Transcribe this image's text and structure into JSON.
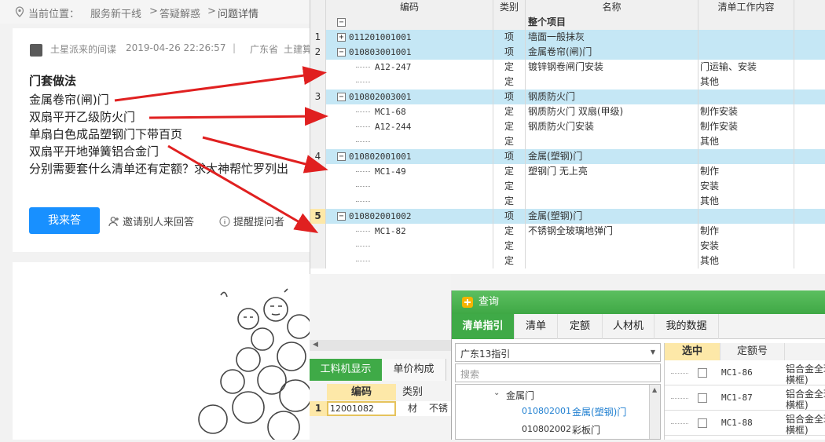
{
  "breadcrumb": {
    "prefix": "当前位置：",
    "items": [
      "服务新干线",
      ">",
      "答疑解惑",
      ">",
      "问题详情"
    ]
  },
  "question": {
    "author": "土星派来的间谍",
    "date": "2019-04-26 22:26:57",
    "sep": "|",
    "region": "广东省",
    "region2": "土建算",
    "title": "门套做法",
    "lines": [
      "金属卷帘(闸)门",
      " 双扇平开乙级防火门",
      "单扇白色成品塑钢门下带百页",
      "双扇平开地弹簧铝合金门",
      "分别需要套什么清单还有定额？求大神帮忙罗列出"
    ],
    "answer_button": "我来答",
    "invite": "邀请别人来回答",
    "remind": "提醒提问者"
  },
  "grid": {
    "headers": [
      "编码",
      "类别",
      "名称",
      "清单工作内容"
    ],
    "rows": [
      {
        "num": "",
        "tog": "−",
        "code": "",
        "type": "",
        "name": "整个项目",
        "work": "",
        "hl": false,
        "bold": true
      },
      {
        "num": "1",
        "tog": "+",
        "code": "011201001001",
        "type": "项",
        "name": "墙面一般抹灰",
        "work": "",
        "hl": true
      },
      {
        "num": "2",
        "tog": "−",
        "code": "010803001001",
        "type": "项",
        "name": "金属卷帘(闸)门",
        "work": "",
        "hl": true
      },
      {
        "num": "",
        "tog": "",
        "code": "A12-247",
        "type": "定",
        "name": "镀锌钢卷闸门安装",
        "work": "门运输、安装",
        "hl": false
      },
      {
        "num": "",
        "tog": "",
        "code": "",
        "type": "定",
        "name": "",
        "work": "其他",
        "hl": false
      },
      {
        "num": "3",
        "tog": "−",
        "code": "010802003001",
        "type": "项",
        "name": "钢质防火门",
        "work": "",
        "hl": true
      },
      {
        "num": "",
        "tog": "",
        "code": "MC1-68",
        "type": "定",
        "name": "钢质防火门 双扇(甲级)",
        "work": "制作安装",
        "hl": false
      },
      {
        "num": "",
        "tog": "",
        "code": "A12-244",
        "type": "定",
        "name": "钢质防火门安装",
        "work": "制作安装",
        "hl": false
      },
      {
        "num": "",
        "tog": "",
        "code": "",
        "type": "定",
        "name": "",
        "work": "其他",
        "hl": false
      },
      {
        "num": "4",
        "tog": "−",
        "code": "010802001001",
        "type": "项",
        "name": "金属(塑钢)门",
        "work": "",
        "hl": true
      },
      {
        "num": "",
        "tog": "",
        "code": "MC1-49",
        "type": "定",
        "name": "塑钢门 无上亮",
        "work": "制作",
        "hl": false
      },
      {
        "num": "",
        "tog": "",
        "code": "",
        "type": "定",
        "name": "",
        "work": "安装",
        "hl": false
      },
      {
        "num": "",
        "tog": "",
        "code": "",
        "type": "定",
        "name": "",
        "work": "其他",
        "hl": false
      },
      {
        "num": "5",
        "tog": "−",
        "code": "010802001002",
        "type": "项",
        "name": "金属(塑钢)门",
        "work": "",
        "hl": true
      },
      {
        "num": "",
        "tog": "",
        "code": "MC1-82",
        "type": "定",
        "name": "不锈钢全玻璃地弹门",
        "work": "制作",
        "hl": false
      },
      {
        "num": "",
        "tog": "",
        "code": "",
        "type": "定",
        "name": "",
        "work": "安装",
        "hl": false
      },
      {
        "num": "",
        "tog": "",
        "code": "",
        "type": "定",
        "name": "",
        "work": "其他",
        "hl": false
      }
    ]
  },
  "lower": {
    "tabs": [
      "工料机显示",
      "单价构成"
    ],
    "headers": [
      "编码",
      "类别"
    ],
    "row": {
      "num": "1",
      "code": "12001082",
      "type": "材",
      "extra": "不锈"
    }
  },
  "query": {
    "title": "查询",
    "tabs": [
      "清单指引",
      "清单",
      "定额",
      "人材机",
      "我的数据"
    ],
    "select_value": "广东13指引",
    "search_placeholder": "搜索",
    "tree": [
      {
        "label": "金属门",
        "code": ""
      },
      {
        "label": "金属(塑钢)门",
        "code": "010802001"
      },
      {
        "label": "彩板门",
        "code": "010802002"
      }
    ],
    "right_headers": [
      "选中",
      "定额号"
    ],
    "right_rows": [
      {
        "code": "MC1-86",
        "name": "铝合金全玻",
        "sub": "横框)"
      },
      {
        "code": "MC1-87",
        "name": "铝合金全玻",
        "sub": "横框)"
      },
      {
        "code": "MC1-88",
        "name": "铝合金全玻",
        "sub": "横框)"
      }
    ]
  },
  "colors": {
    "accent": "#1890ff",
    "green": "#3faa47",
    "highlight": "#c5e7f5",
    "arrow": "#e02020"
  }
}
